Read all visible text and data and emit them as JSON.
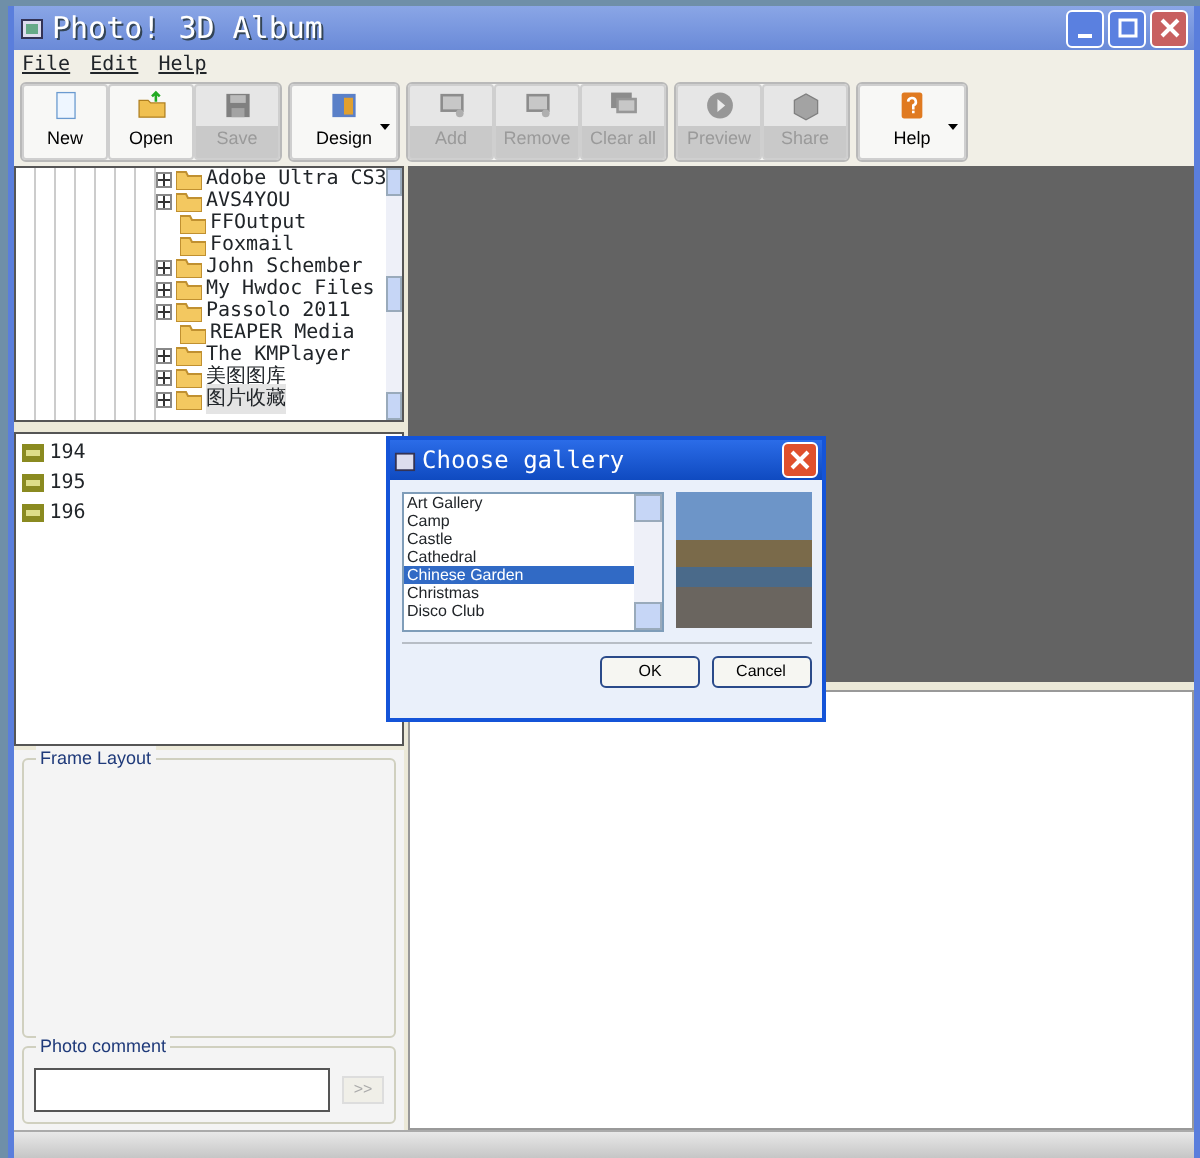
{
  "window": {
    "title": "Photo! 3D Album"
  },
  "menu": [
    {
      "label": "File"
    },
    {
      "label": "Edit"
    },
    {
      "label": "Help"
    }
  ],
  "toolbar": [
    {
      "label": "New",
      "disabled": false,
      "dropdown": false
    },
    {
      "label": "Open",
      "disabled": false,
      "dropdown": false
    },
    {
      "label": "Save",
      "disabled": true,
      "dropdown": false
    },
    {
      "label": "Design",
      "disabled": false,
      "dropdown": true
    },
    {
      "label": "Add",
      "disabled": true,
      "dropdown": false
    },
    {
      "label": "Remove",
      "disabled": true,
      "dropdown": false
    },
    {
      "label": "Clear all",
      "disabled": true,
      "dropdown": false
    },
    {
      "label": "Preview",
      "disabled": true,
      "dropdown": false
    },
    {
      "label": "Share",
      "disabled": true,
      "dropdown": false
    },
    {
      "label": "Help",
      "disabled": false,
      "dropdown": true
    }
  ],
  "folder_tree": [
    {
      "label": "Adobe Ultra CS3",
      "expandable": true,
      "selected": false
    },
    {
      "label": "AVS4YOU",
      "expandable": true,
      "selected": false
    },
    {
      "label": "FFOutput",
      "expandable": false,
      "selected": false
    },
    {
      "label": "Foxmail",
      "expandable": false,
      "selected": false
    },
    {
      "label": "John Schember",
      "expandable": true,
      "selected": false
    },
    {
      "label": "My Hwdoc Files",
      "expandable": true,
      "selected": false
    },
    {
      "label": "Passolo 2011",
      "expandable": true,
      "selected": false
    },
    {
      "label": "REAPER Media",
      "expandable": false,
      "selected": false
    },
    {
      "label": "The KMPlayer",
      "expandable": true,
      "selected": false
    },
    {
      "label": "美图图库",
      "expandable": true,
      "selected": false
    },
    {
      "label": "图片收藏",
      "expandable": true,
      "selected": true
    }
  ],
  "files": [
    {
      "label": "194"
    },
    {
      "label": "195"
    },
    {
      "label": "196"
    }
  ],
  "frame_layout": {
    "title": "Frame Layout"
  },
  "photo_comment": {
    "title": "Photo comment",
    "button": ">>"
  },
  "dialog": {
    "title": "Choose gallery",
    "items": [
      {
        "label": "Art Gallery",
        "selected": false
      },
      {
        "label": "Camp",
        "selected": false
      },
      {
        "label": "Castle",
        "selected": false
      },
      {
        "label": "Cathedral",
        "selected": false
      },
      {
        "label": "Chinese Garden",
        "selected": true
      },
      {
        "label": "Christmas",
        "selected": false
      },
      {
        "label": "Disco Club",
        "selected": false
      }
    ],
    "buttons": [
      "OK",
      "Cancel"
    ]
  }
}
